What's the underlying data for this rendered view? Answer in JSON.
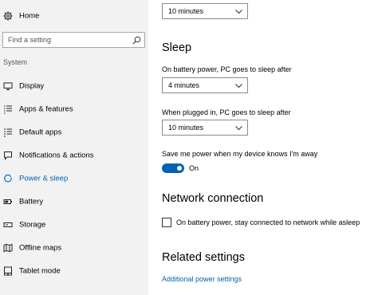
{
  "sidebar": {
    "home_label": "Home",
    "search_placeholder": "Find a setting",
    "section_title": "System",
    "items": [
      {
        "label": "Display",
        "icon": "monitor-icon"
      },
      {
        "label": "Apps & features",
        "icon": "list-icon"
      },
      {
        "label": "Default apps",
        "icon": "default-apps-icon"
      },
      {
        "label": "Notifications & actions",
        "icon": "notification-icon"
      },
      {
        "label": "Power & sleep",
        "icon": "power-icon",
        "selected": true
      },
      {
        "label": "Battery",
        "icon": "battery-icon"
      },
      {
        "label": "Storage",
        "icon": "storage-icon"
      },
      {
        "label": "Offline maps",
        "icon": "map-icon"
      },
      {
        "label": "Tablet mode",
        "icon": "tablet-icon"
      }
    ]
  },
  "main": {
    "top_dropdown_value": "10 minutes",
    "sleep": {
      "heading": "Sleep",
      "battery_label": "On battery power, PC goes to sleep after",
      "battery_value": "4 minutes",
      "plugged_label": "When plugged in, PC goes to sleep after",
      "plugged_value": "10 minutes",
      "save_power_label": "Save me power when my device knows I'm away",
      "toggle_state": "On"
    },
    "network": {
      "heading": "Network connection",
      "checkbox_label": "On battery power, stay connected to network while asleep"
    },
    "related": {
      "heading": "Related settings",
      "link": "Additional power settings"
    }
  },
  "colors": {
    "accent": "#0063b1",
    "sidebar_bg": "#f2f2f2"
  }
}
